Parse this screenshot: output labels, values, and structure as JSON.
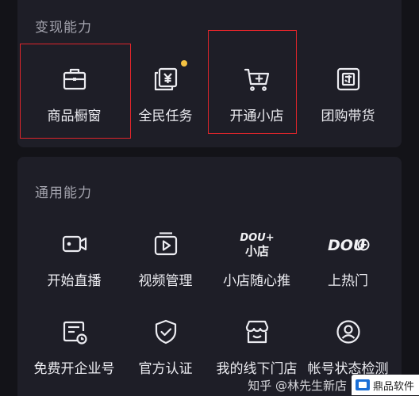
{
  "sections": [
    {
      "title": "变现能力",
      "items": [
        {
          "label": "商品橱窗",
          "icon": "briefcase-icon"
        },
        {
          "label": "全民任务",
          "icon": "yuan-card-icon"
        },
        {
          "label": "开通小店",
          "icon": "shopping-cart-icon"
        },
        {
          "label": "团购带货",
          "icon": "group-buy-icon"
        }
      ]
    },
    {
      "title": "通用能力",
      "items": [
        {
          "label": "开始直播",
          "icon": "camera-icon"
        },
        {
          "label": "视频管理",
          "icon": "video-play-icon"
        },
        {
          "label": "小店随心推",
          "icon": "dou-plus-shop-icon",
          "icon_text": {
            "top": "DOU+",
            "bottom": "小店"
          }
        },
        {
          "label": "上热门",
          "icon": "dou-plus-icon",
          "icon_text": {
            "top": "DOU"
          }
        },
        {
          "label": "免费开企业号",
          "icon": "enterprise-clock-icon"
        },
        {
          "label": "官方认证",
          "icon": "shield-check-icon"
        },
        {
          "label": "我的线下门店",
          "icon": "storefront-icon"
        },
        {
          "label": "帐号状态检测",
          "icon": "account-check-icon"
        }
      ]
    }
  ],
  "watermark": {
    "text": "知乎 @林先生新店",
    "logo_text": "鼎品软件"
  },
  "colors": {
    "background": "#131318",
    "panel": "#1e1e27",
    "highlight": "#e0252b",
    "badge_dot": "#f5c242"
  }
}
